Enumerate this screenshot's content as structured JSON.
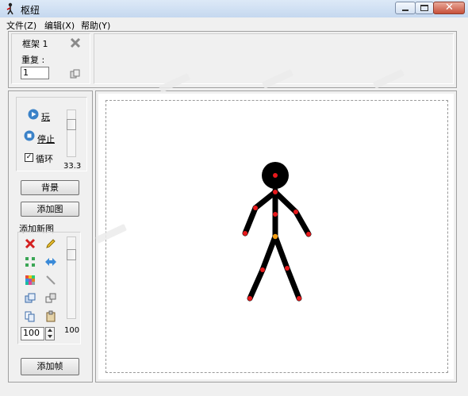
{
  "window": {
    "title": "枢纽"
  },
  "menu": {
    "file": "文件(Z)",
    "edit": "编辑(X)",
    "help": "帮助(Y)"
  },
  "frame": {
    "label": "框架 1",
    "repeat_label": "重复 :",
    "repeat_value": "1"
  },
  "playback": {
    "play": "玩",
    "stop": "停止",
    "loop": "循环",
    "loop_checked": true,
    "fps": "33.3"
  },
  "buttons": {
    "background": "背景",
    "add_image": "添加图",
    "add_frame": "添加帧"
  },
  "new_figure": {
    "label": "添加新图",
    "value": "100",
    "scroll_value": "100"
  },
  "colors": {
    "stick": "#000000",
    "joint": "#e8191c",
    "center_joint": "#f39c12"
  }
}
